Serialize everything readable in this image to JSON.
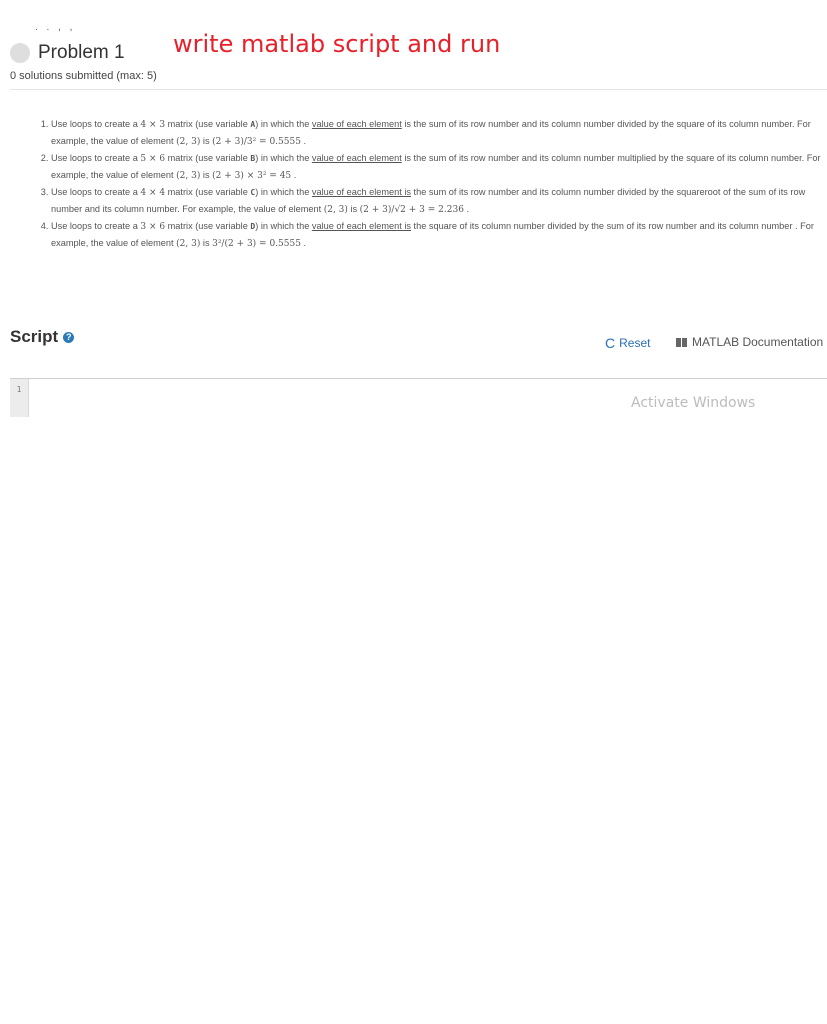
{
  "breadcrumb_dots": ". . , ,",
  "problem": {
    "title": "Problem 1",
    "submitted": "0 solutions submitted (max: 5)"
  },
  "annotation": "write matlab script and run",
  "items": [
    {
      "a": "Use loops to create a ",
      "m1": "4 × 3",
      "b": " matrix (use variable ",
      "var": "A",
      "c": ") in which the ",
      "u": "value of each element",
      "d": " is the sum of its row number and its column number divided by the square of its column number. For example, the value of element ",
      "m2": "(2, 3)",
      "e": " is ",
      "m3": "(2 + 3)/3² = 0.5555",
      "f": " ."
    },
    {
      "a": "Use loops to create a ",
      "m1": "5 × 6",
      "b": " matrix (use variable ",
      "var": "B",
      "c": ") in which the ",
      "u": "value of each element",
      "d": " is the sum of its row number and its column number multiplied by the square of its column number. For example, the value of element ",
      "m2": "(2, 3)",
      "e": " is ",
      "m3": "(2 + 3) × 3² = 45",
      "f": " ."
    },
    {
      "a": "Use loops to create a ",
      "m1": "4 × 4",
      "b": " matrix (use variable ",
      "var": "C",
      "c": ") in which the ",
      "u": "value of each element is",
      "d": " the sum of its row number and its column number divided by the squareroot of the sum of its row number and its column number. For example, the value of element ",
      "m2": "(2, 3)",
      "e": " is ",
      "m3": "(2 + 3)/√2 + 3 = 2.236",
      "f": " ."
    },
    {
      "a": "Use loops to create a ",
      "m1": "3 × 6",
      "b": " matrix (use variable ",
      "var": "D",
      "c": ") in which the ",
      "u": "value of each element is",
      "d": " the square of its column number divided by the sum of its row number and its column number . For example, the value of element ",
      "m2": "(2, 3)",
      "e": " is ",
      "m3": "3²/(2 + 3) = 0.5555",
      "f": " ."
    }
  ],
  "script": {
    "title": "Script",
    "help_icon": "?",
    "reset_icon": "C",
    "reset_label": "Reset",
    "docs_label": "MATLAB Documentation",
    "line_number": "1"
  },
  "watermark": "Activate Windows"
}
